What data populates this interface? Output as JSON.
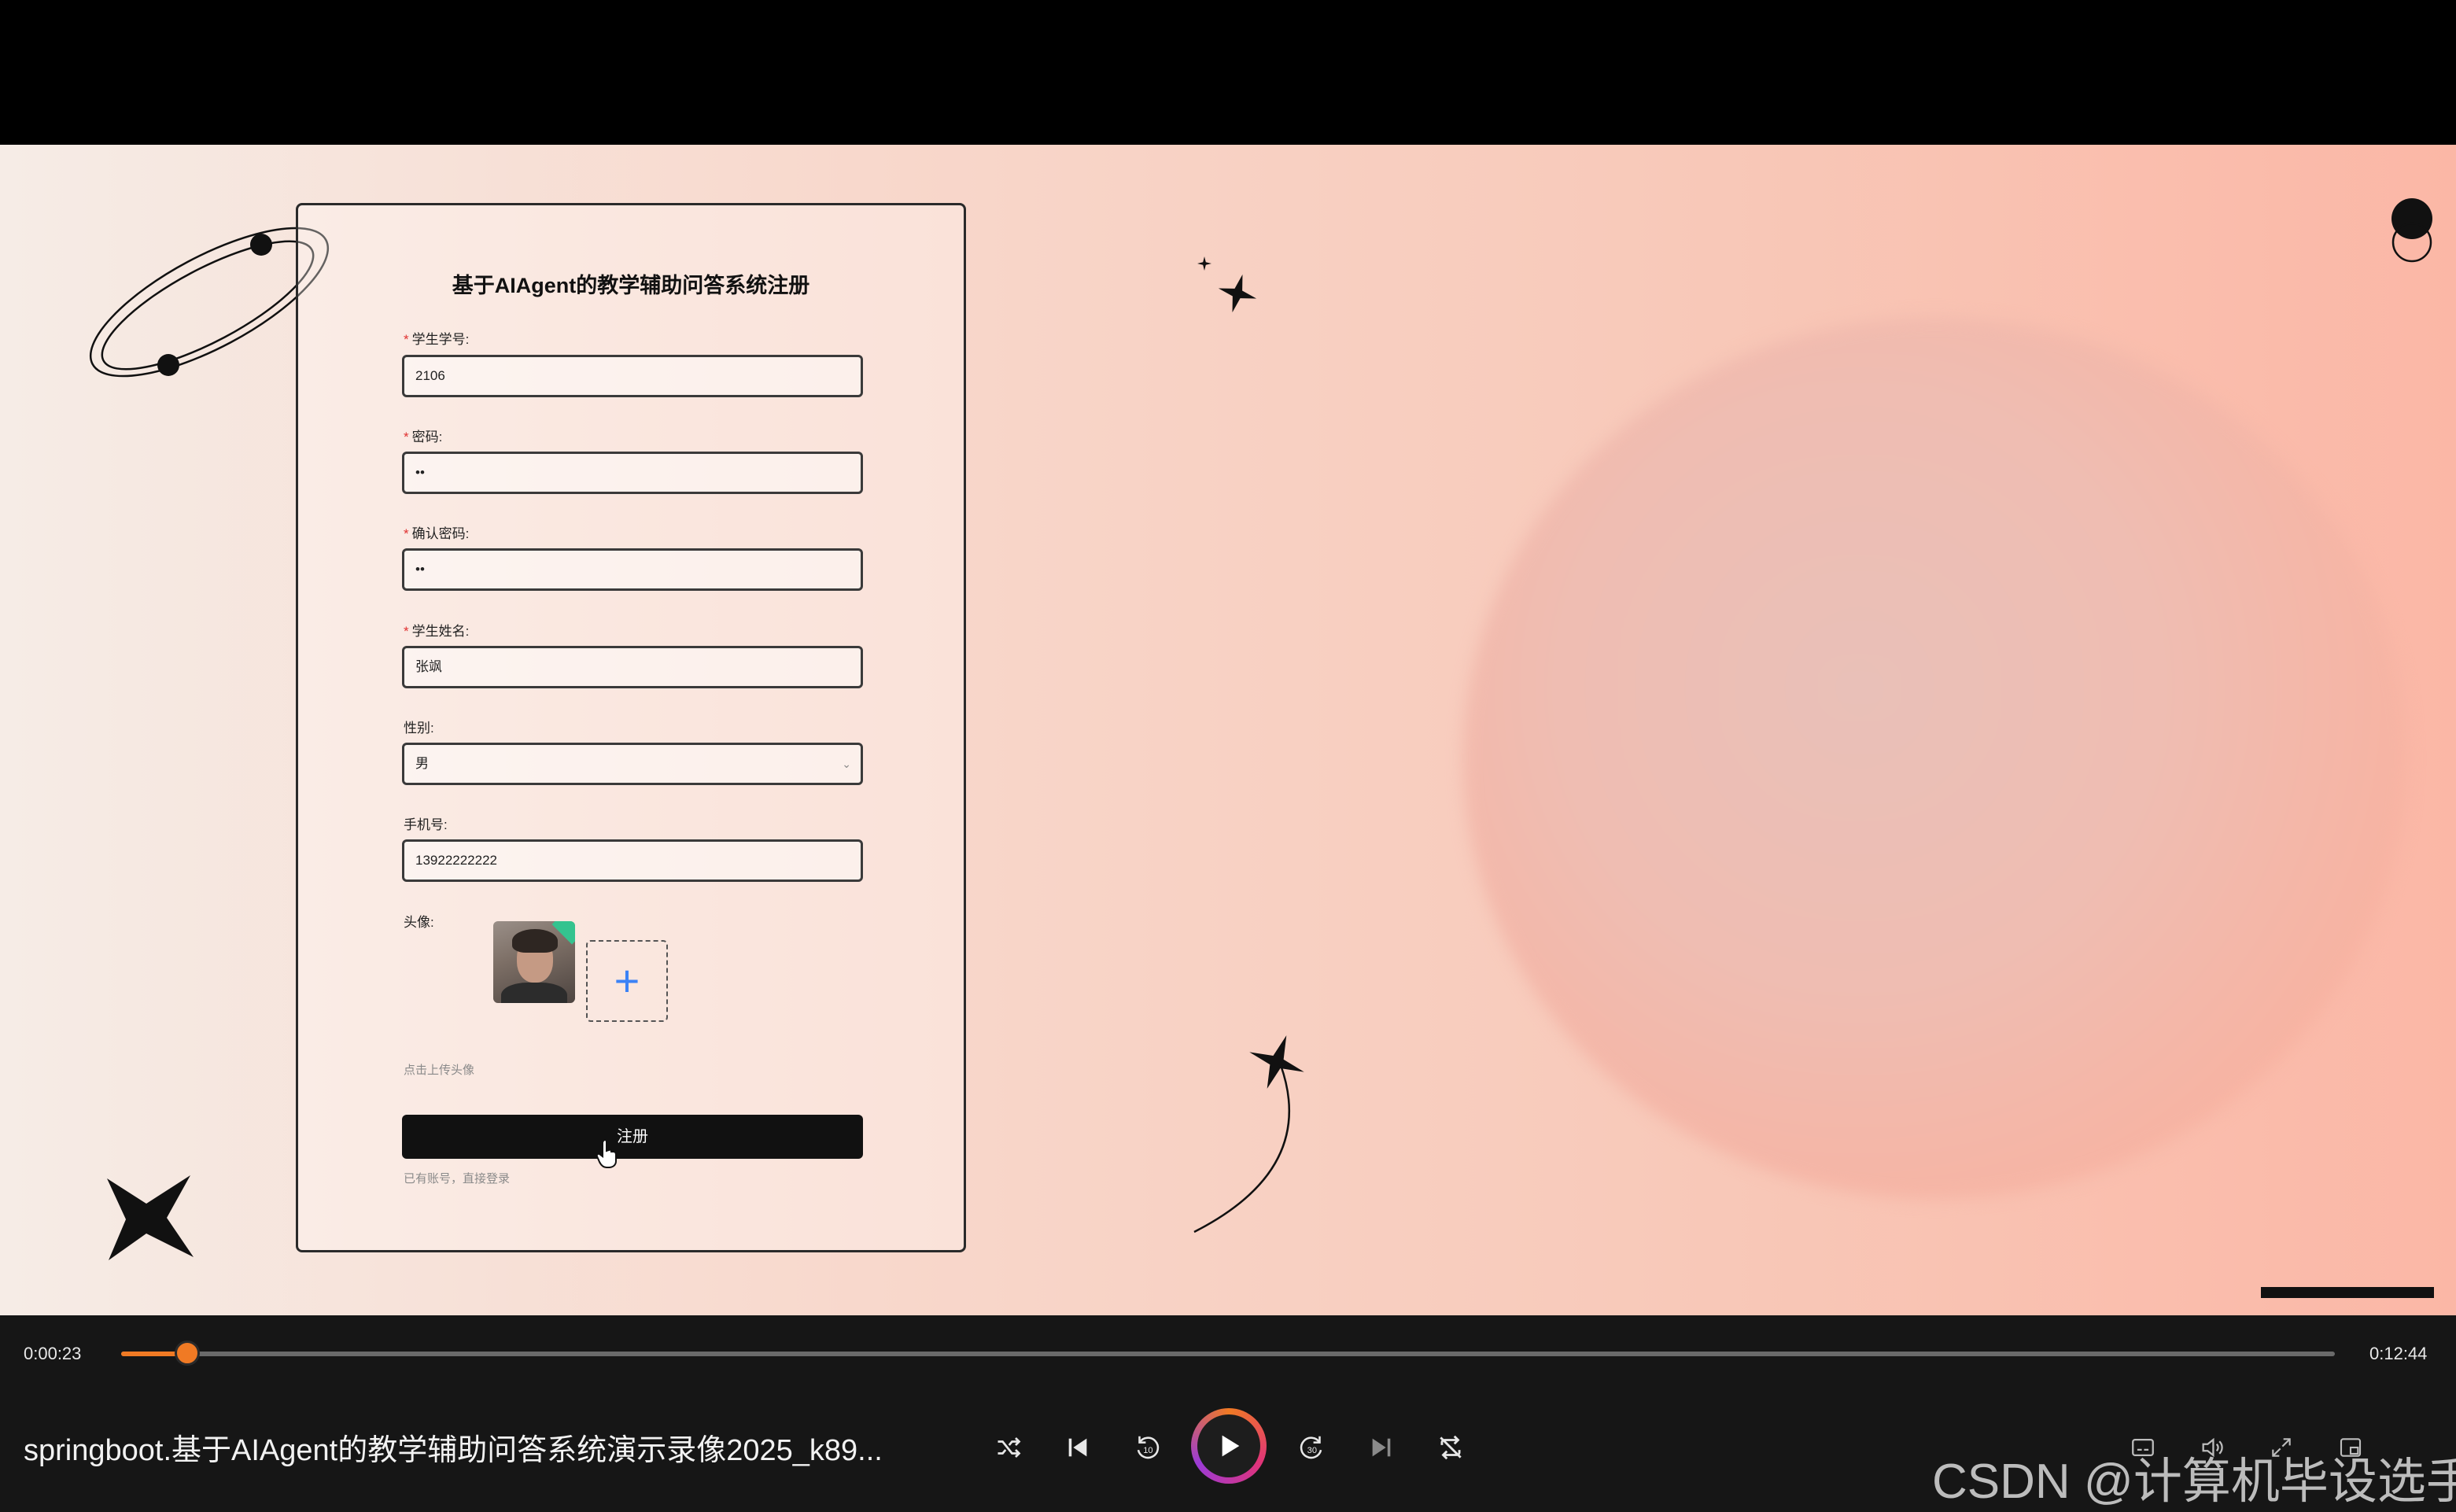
{
  "page": {
    "form_title": "基于AIAgent的教学辅助问答系统注册",
    "fields": [
      {
        "label": "学生学号:",
        "required": true,
        "value": "2106"
      },
      {
        "label": "密码:",
        "required": true,
        "value": "••"
      },
      {
        "label": "确认密码:",
        "required": true,
        "value": "••"
      },
      {
        "label": "学生姓名:",
        "required": true,
        "value": "张飒"
      },
      {
        "label": "性别:",
        "required": false,
        "value": "男"
      },
      {
        "label": "手机号:",
        "required": false,
        "value": "13922222222"
      }
    ],
    "avatar_label": "头像:",
    "upload_plus": "+",
    "upload_hint": "点击上传头像",
    "submit_label": "注册",
    "login_link": "已有账号，直接登录"
  },
  "player": {
    "current_time": "0:00:23",
    "total_time": "0:12:44",
    "progress": 0.03,
    "video_title": "springboot.基于AIAgent的教学辅助问答系统演示录像2025_k89...",
    "watermark": "CSDN @计算机毕设选手",
    "accent_color": "#f07a24"
  },
  "icons": {
    "shuffle": "shuffle-icon",
    "previous": "skip-previous-icon",
    "rewind": "rewind-10-icon",
    "play": "play-icon",
    "forward": "forward-30-icon",
    "next": "skip-next-icon",
    "repeat": "repeat-off-icon",
    "subtitles": "subtitles-icon",
    "volume": "volume-icon",
    "expand": "expand-icon",
    "miniplayer": "miniplayer-icon"
  }
}
